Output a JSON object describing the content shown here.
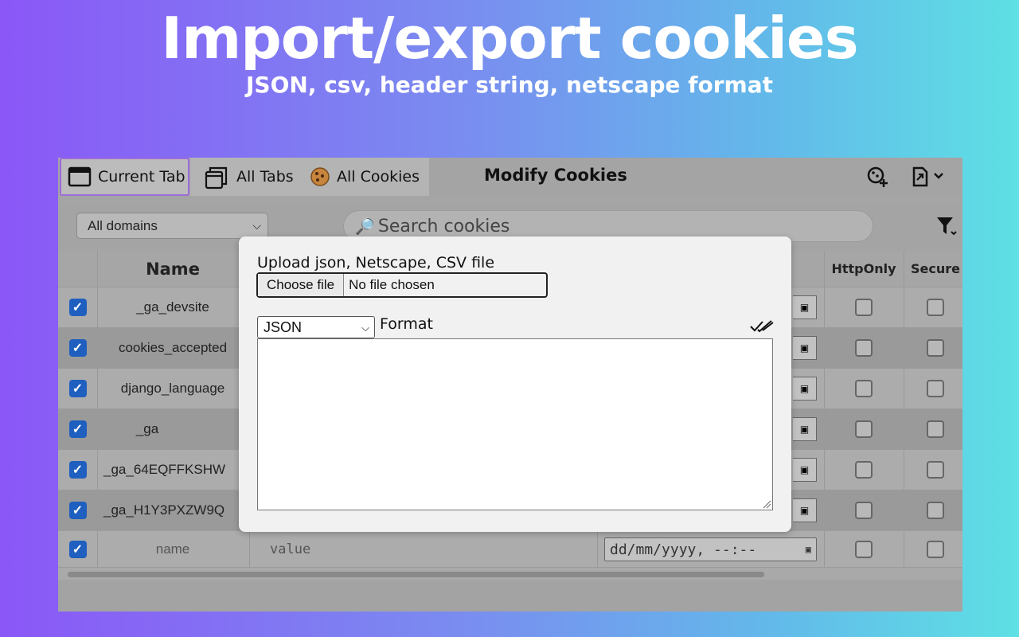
{
  "hero": {
    "title": "Import/export cookies",
    "subtitle": "JSON, csv, header string, netscape format"
  },
  "tabs": {
    "current": "Current Tab",
    "all_tabs": "All Tabs",
    "all_cookies": "All Cookies"
  },
  "header": {
    "title": "Modify Cookies"
  },
  "filters": {
    "domain": "All domains",
    "search_placeholder": "Search cookies"
  },
  "table": {
    "columns": {
      "name": "Name",
      "httponly": "HttpOnly",
      "secure": "Secure"
    },
    "rows": [
      {
        "name": "_ga_devsite",
        "checked": true
      },
      {
        "name": "cookies_accepted",
        "checked": true
      },
      {
        "name": "django_language",
        "checked": true
      },
      {
        "name": "_ga",
        "checked": true
      },
      {
        "name": "_ga_64EQFFKSHW",
        "checked": true
      },
      {
        "name": "_ga_H1Y3PXZW9Q",
        "checked": true
      }
    ],
    "new_row": {
      "name_placeholder": "name",
      "value_placeholder": "value",
      "date_placeholder": "dd/mm/yyyy, --:--"
    }
  },
  "modal": {
    "upload_label": "Upload json, Netscape, CSV file",
    "choose_file": "Choose file",
    "no_file": "No file chosen",
    "format_value": "JSON",
    "format_label": "Format",
    "textarea_value": ""
  },
  "colors": {
    "checkbox_blue": "#1f5fbf",
    "active_tab_border": "#9d6cd9"
  }
}
